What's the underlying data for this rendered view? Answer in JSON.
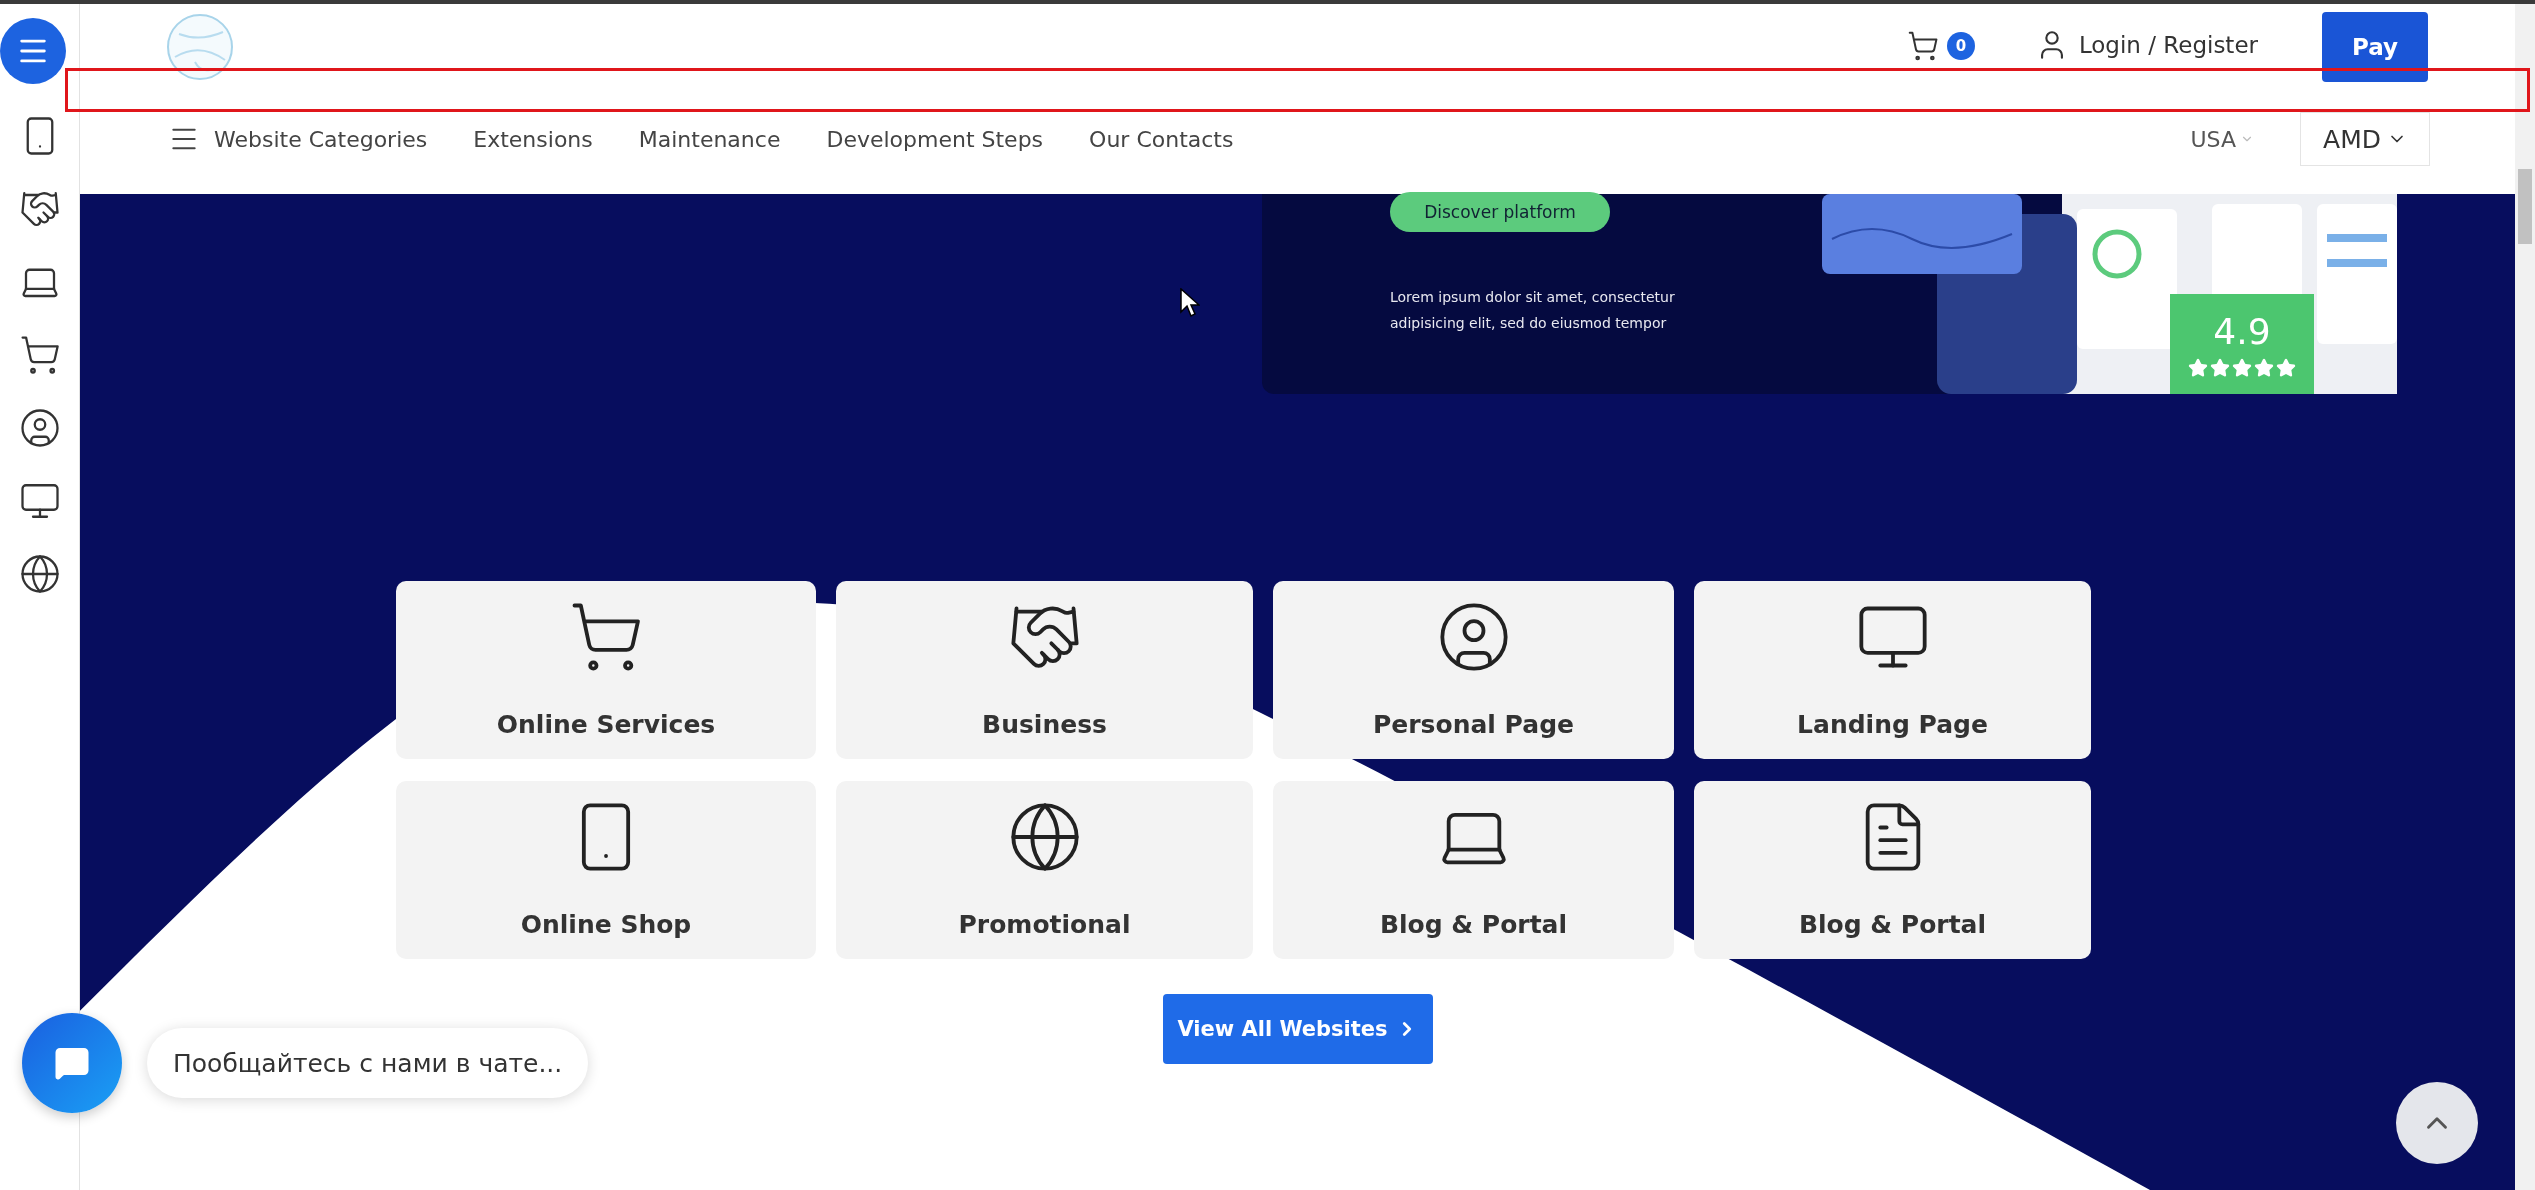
{
  "header": {
    "cart_count": "0",
    "login": "Login / Register",
    "pay": "Pay"
  },
  "nav": {
    "categories": "Website Categories",
    "links": [
      "Extensions",
      "Maintenance",
      "Development Steps",
      "Our Contacts"
    ],
    "country": "USA",
    "currency": "AMD"
  },
  "promo": {
    "button": "Discover platform",
    "text": "Lorem ipsum dolor sit amet, consectetur adipisicing elit, sed do eiusmod tempor",
    "rating": "4.9",
    "stars": 5
  },
  "categories": [
    {
      "label": "Online Services"
    },
    {
      "label": "Business"
    },
    {
      "label": "Personal Page"
    },
    {
      "label": "Landing Page"
    },
    {
      "label": "Online Shop"
    },
    {
      "label": "Promotional"
    },
    {
      "label": "Blog & Portal"
    },
    {
      "label": "Blog & Portal"
    }
  ],
  "view_all": "View All Websites",
  "chat": {
    "prompt": "Пообщайтесь с нами в чате..."
  }
}
